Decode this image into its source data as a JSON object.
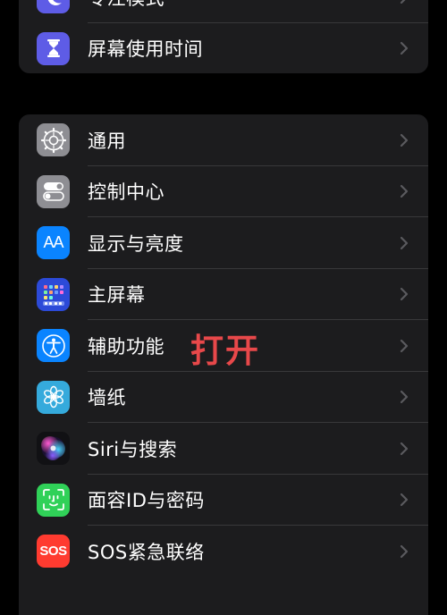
{
  "group_top": {
    "items": [
      {
        "label": "专注模式",
        "icon": "moon-icon",
        "color": "#5e5ce6"
      },
      {
        "label": "屏幕使用时间",
        "icon": "hourglass-icon",
        "color": "#5e5ce6"
      }
    ]
  },
  "group_main": {
    "items": [
      {
        "label": "通用",
        "icon": "gear-icon",
        "color": "#8e8e93"
      },
      {
        "label": "控制中心",
        "icon": "toggles-icon",
        "color": "#8e8e93"
      },
      {
        "label": "显示与亮度",
        "icon": "text-size-icon",
        "icon_text": "AA",
        "color": "#0a84ff"
      },
      {
        "label": "主屏幕",
        "icon": "home-screen-grid-icon",
        "color": "#2c4ad8"
      },
      {
        "label": "辅助功能",
        "icon": "accessibility-icon",
        "color": "#0a84ff"
      },
      {
        "label": "墙纸",
        "icon": "flower-icon",
        "color": "#35aadc"
      },
      {
        "label": "Siri与搜索",
        "icon": "siri-icon",
        "color": "#1c1c1e"
      },
      {
        "label": "面容ID与密码",
        "icon": "face-id-icon",
        "color": "#30d158"
      },
      {
        "label": "SOS紧急联络",
        "icon": "sos-icon",
        "icon_text": "SOS",
        "color": "#ff3b30"
      }
    ]
  },
  "annotation": {
    "text": "打开",
    "color": "#e8484a"
  }
}
